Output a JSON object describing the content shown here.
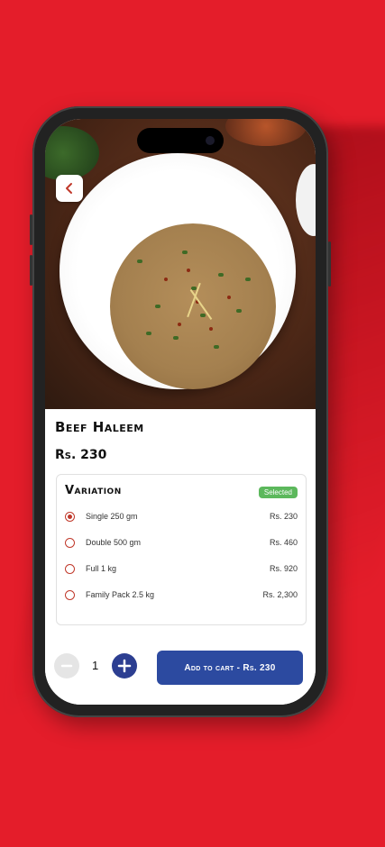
{
  "product": {
    "name": "Beef Haleem",
    "price": "Rs. 230"
  },
  "variation": {
    "title": "Variation",
    "badge": "Selected",
    "options": [
      {
        "label": "Single 250 gm",
        "price": "Rs. 230",
        "selected": true
      },
      {
        "label": "Double 500 gm",
        "price": "Rs. 460",
        "selected": false
      },
      {
        "label": "Full 1 kg",
        "price": "Rs. 920",
        "selected": false
      },
      {
        "label": "Family Pack 2.5 kg",
        "price": "Rs. 2,300",
        "selected": false
      }
    ]
  },
  "cart": {
    "quantity": "1",
    "minus_icon": "minus-icon",
    "plus_icon": "plus-icon",
    "add_label": "Add to cart - Rs. 230"
  },
  "nav": {
    "back_icon": "chevron-left-icon"
  },
  "colors": {
    "background": "#e41d2a",
    "accent": "#2c4aa0",
    "selected_badge": "#5cb85c",
    "radio": "#c0392b"
  }
}
